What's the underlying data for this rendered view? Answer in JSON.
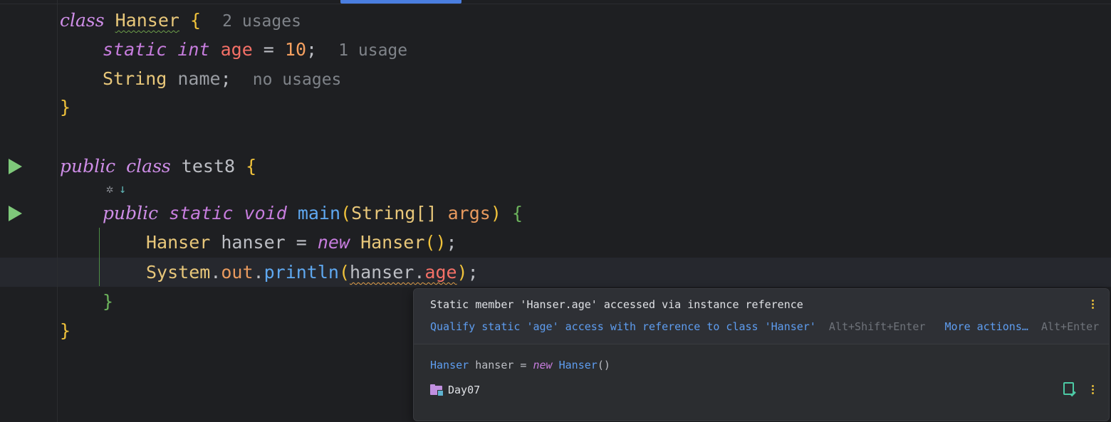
{
  "code": {
    "line1": {
      "kw": "class",
      "name": "Hanser",
      "brace": "{",
      "hint": "2 usages"
    },
    "line2": {
      "kw1": "static",
      "kw2": "int",
      "field": "age",
      "eq": " = ",
      "value": "10",
      "semi": ";",
      "hint": "1 usage"
    },
    "line3": {
      "type": "String",
      "field": "name",
      "semi": ";",
      "hint": "no usages"
    },
    "line4": {
      "brace": "}"
    },
    "line6": {
      "kw1": "public",
      "kw2": "class",
      "name": "test8",
      "brace": "{"
    },
    "line8": {
      "kw1": "public",
      "kw2": "static",
      "kw3": "void",
      "method": "main",
      "open": "(",
      "type": "String[]",
      "param": "args",
      "close": ")",
      "brace": "{"
    },
    "line9": {
      "type": "Hanser",
      "var": "hanser",
      "eq": " = ",
      "kw": "new",
      "ctor": "Hanser",
      "paren_open": "(",
      "paren_close": ")",
      "semi": ";"
    },
    "line10": {
      "cls": "System",
      "dot1": ".",
      "out": "out",
      "dot2": ".",
      "method": "println",
      "open": "(",
      "var": "hanser",
      "dot3": ".",
      "field": "age",
      "close": ")",
      "semi": ";"
    },
    "line11": {
      "brace": "}"
    },
    "line12": {
      "brace": "}"
    }
  },
  "popup": {
    "warning": "Static member 'Hanser.age' accessed via instance reference",
    "quick_fix": "Qualify static 'age' access with reference to class 'Hanser'",
    "quick_fix_shortcut": "Alt+Shift+Enter",
    "more_actions": "More actions…",
    "more_actions_shortcut": "Alt+Enter",
    "declaration": {
      "type": "Hanser",
      "var": " hanser = ",
      "kw": "new",
      "ctor": "Hanser",
      "parens": "()"
    },
    "module": "Day07"
  },
  "colors": {
    "background": "#1e1f22",
    "keyword": "#cf8ee8",
    "class": "#e8c77a",
    "field": "#f47067",
    "number": "#f5a060",
    "method": "#5fa8f0",
    "link": "#5e9df0",
    "run": "#7ec87a"
  }
}
